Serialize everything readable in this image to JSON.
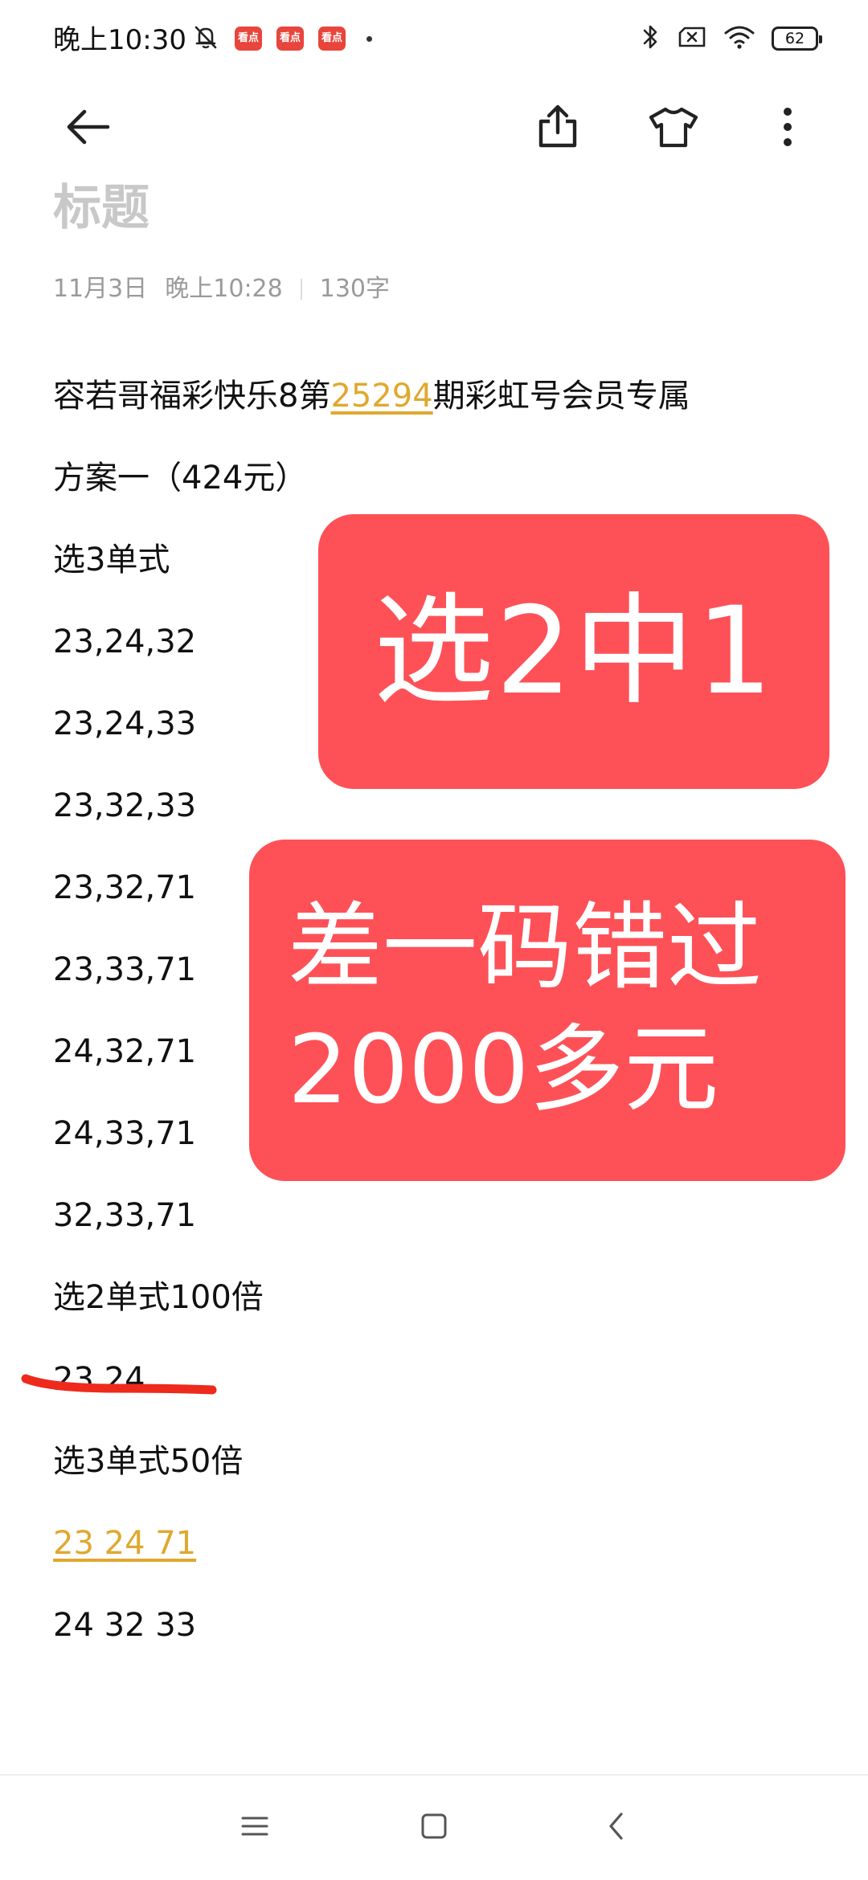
{
  "status_bar": {
    "time": "晚上10:30",
    "app_badge_label": "看点",
    "battery_level": "62",
    "icons": [
      "mute-bell-icon",
      "app-badge-icon",
      "bluetooth-icon",
      "no-sim-icon",
      "wifi-icon",
      "battery-icon"
    ]
  },
  "toolbar": {
    "icons": [
      "back-arrow-icon",
      "share-icon",
      "theme-shirt-icon",
      "more-icon"
    ]
  },
  "note": {
    "title_placeholder": "标题",
    "date": "11月3日",
    "time": "晚上10:28",
    "char_count": "130字",
    "header_line": {
      "before": "容若哥福彩快乐8第",
      "issue": "25294",
      "after": "期彩虹号会员专属"
    },
    "lines": [
      "方案一（424元）",
      "选3单式",
      "23,24,32",
      "23,24,33",
      "23,32,33",
      "23,32,71",
      "23,33,71",
      "24,32,71",
      "24,33,71",
      "32,33,71",
      "选2单式100倍",
      "23 24",
      "选3单式50倍"
    ],
    "highlight_line": "23 24 71",
    "last_line": "24 32 33"
  },
  "overlays": {
    "box1": "选2中1",
    "box2_line1": "差一码错过",
    "box2_line2": "2000多元"
  },
  "colors": {
    "overlay_red": "#fd5157",
    "highlight_gold": "#e0a82e",
    "title_gray": "#c8c8c8",
    "meta_gray": "#9a9a9a",
    "stroke_red": "#ee2a1c"
  },
  "nav": {
    "icons": [
      "menu-icon",
      "home-square-icon",
      "back-chevron-icon"
    ]
  }
}
